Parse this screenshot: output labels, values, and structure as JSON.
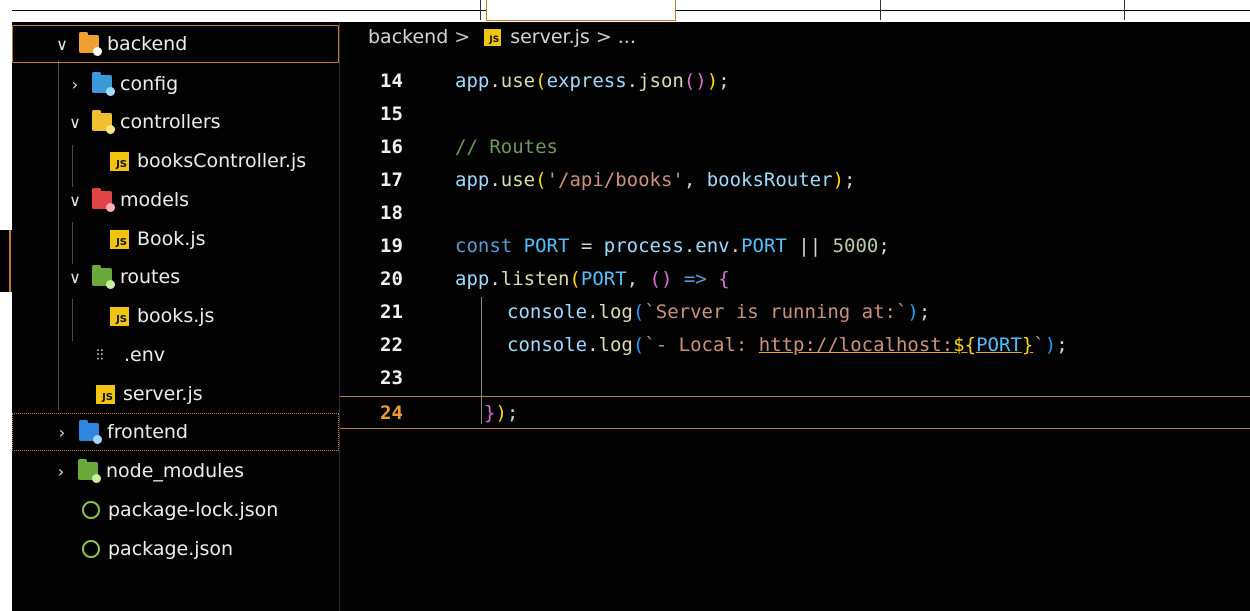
{
  "explorer": {
    "items": [
      {
        "label": "backend",
        "chevron": "∨",
        "icon": "folder-backend-icon",
        "color": "#f0a030"
      },
      {
        "label": "config",
        "chevron": "›",
        "icon": "folder-config-icon",
        "color": "#3a9ad9"
      },
      {
        "label": "controllers",
        "chevron": "∨",
        "icon": "folder-controllers-icon",
        "color": "#f0c030"
      },
      {
        "label": "booksController.js",
        "icon": "js-file-icon"
      },
      {
        "label": "models",
        "chevron": "∨",
        "icon": "folder-models-icon",
        "color": "#e04545"
      },
      {
        "label": "Book.js",
        "icon": "js-file-icon"
      },
      {
        "label": "routes",
        "chevron": "∨",
        "icon": "folder-routes-icon",
        "color": "#6aaa3a"
      },
      {
        "label": "books.js",
        "icon": "js-file-icon"
      },
      {
        "label": ".env",
        "icon": "env-file-icon"
      },
      {
        "label": "server.js",
        "icon": "js-file-icon"
      },
      {
        "label": "frontend",
        "chevron": "›",
        "icon": "folder-frontend-icon",
        "color": "#2f86e0"
      },
      {
        "label": "node_modules",
        "chevron": "›",
        "icon": "folder-node-modules-icon",
        "color": "#6aaa3a"
      },
      {
        "label": "package-lock.json",
        "icon": "npm-json-icon"
      },
      {
        "label": "package.json",
        "icon": "npm-json-icon"
      }
    ]
  },
  "breadcrumb": {
    "folder": "backend",
    "file": "server.js",
    "more": "...",
    "separator": ">"
  },
  "js_badge": "JS",
  "editor": {
    "line_numbers": [
      "14",
      "15",
      "16",
      "17",
      "18",
      "19",
      "20",
      "21",
      "22",
      "23",
      "24"
    ],
    "lines": {
      "l14": {
        "a": "app",
        "b": ".",
        "c": "use",
        "d": "(",
        "e": "express",
        "f": ".",
        "g": "json",
        "h": "()",
        "i": ")",
        "j": ";"
      },
      "l16": {
        "a": "// Routes"
      },
      "l17": {
        "a": "app",
        "b": ".",
        "c": "use",
        "d": "(",
        "e": "'/api/books'",
        "f": ", ",
        "g": "booksRouter",
        "h": ")",
        "i": ";"
      },
      "l19": {
        "a": "const",
        "b": " ",
        "c": "PORT",
        "d": " = ",
        "e": "process",
        "f": ".",
        "g": "env",
        "h": ".",
        "i": "PORT",
        "j": " || ",
        "k": "5000",
        "l": ";"
      },
      "l20": {
        "a": "app",
        "b": ".",
        "c": "listen",
        "d": "(",
        "e": "PORT",
        "f": ", ",
        "g": "()",
        "h": " => ",
        "i": "{"
      },
      "l21": {
        "a": "console",
        "b": ".",
        "c": "log",
        "d": "(",
        "e": "`Server is running at:`",
        "f": ")",
        "g": ";"
      },
      "l22": {
        "a": "console",
        "b": ".",
        "c": "log",
        "d": "(",
        "e": "`- Local: ",
        "f": "http://localhost:",
        "g": "${",
        "h": "PORT",
        "i": "}",
        "j": "`",
        "k": ")",
        "l": ";"
      },
      "l24": {
        "a": "}",
        "b": ")",
        "c": ";"
      }
    }
  },
  "colors": {
    "accent_border": "#c27d1a",
    "active_line_number": "#f09a2e",
    "background": "#020202"
  }
}
